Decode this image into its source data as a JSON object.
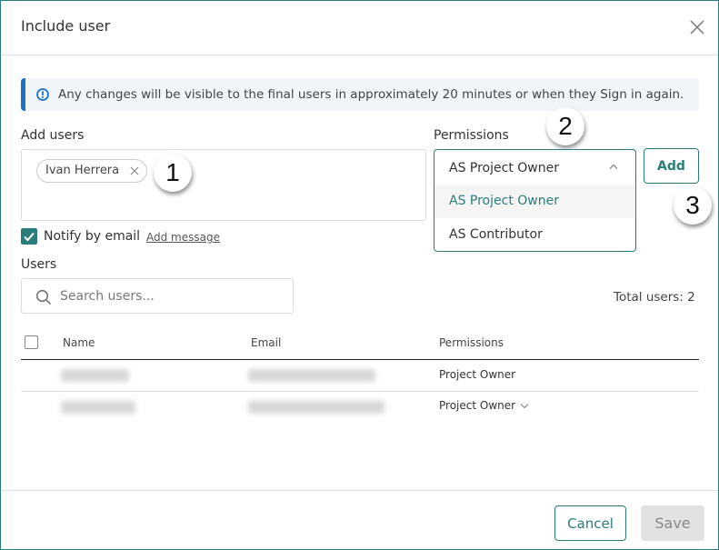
{
  "dialog": {
    "title": "Include user",
    "close_icon": "close-icon"
  },
  "info_banner": {
    "icon": "info-icon",
    "text": "Any changes will be visible to the final users in approximately 20 minutes or when they Sign in again.",
    "accent_color": "#1a73c9"
  },
  "add_users": {
    "label": "Add users",
    "chips": [
      {
        "label": "Ivan Herrera",
        "remove_icon": "close-icon"
      }
    ]
  },
  "permissions": {
    "label": "Permissions",
    "selected": "AS Project Owner",
    "options": [
      "AS Project Owner",
      "AS Contributor"
    ],
    "expanded": true
  },
  "add_button": {
    "label": "Add"
  },
  "notify": {
    "label": "Notify by email",
    "checked": true,
    "add_message_label": "Add message"
  },
  "users": {
    "label": "Users",
    "search_placeholder": "Search users...",
    "search_value": "",
    "total": "Total users: 2",
    "columns": [
      "Name",
      "Email",
      "Permissions"
    ],
    "rows": [
      {
        "name": "[redacted]",
        "email": "[redacted]",
        "permission": "Project Owner",
        "has_dropdown": false
      },
      {
        "name": "[redacted]",
        "email": "[redacted]",
        "permission": "Project Owner",
        "has_dropdown": true
      }
    ]
  },
  "annotations": [
    "1",
    "2",
    "3"
  ],
  "footer": {
    "cancel_label": "Cancel",
    "save_label": "Save",
    "save_enabled": false
  },
  "colors": {
    "accent": "#2a7d7b",
    "info": "#1a73c9",
    "disabled_bg": "#e2e2e2"
  }
}
